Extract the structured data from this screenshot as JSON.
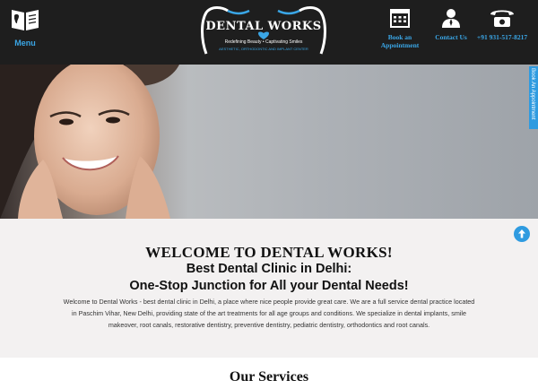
{
  "header": {
    "menu_label": "Menu",
    "logo": {
      "title": "DENTAL WORKS",
      "tagline": "Redefining Beauty • Captivating Smiles",
      "subtitle": "AESTHETIC, ORTHODONTIC AND IMPLANT CENTER"
    },
    "book_label_line1": "Book an",
    "book_label_line2": "Appointment",
    "contact_label": "Contact Us",
    "phone": "+91 931-517-8217"
  },
  "side_tab": {
    "label": "Book An Appointment"
  },
  "welcome": {
    "title": "WELCOME TO DENTAL WORKS!",
    "subtitle_line1": "Best Dental Clinic in Delhi:",
    "subtitle_line2": "One-Stop Junction for All your Dental Needs!",
    "body": "Welcome to Dental Works - best dental clinic in Delhi, a place where nice people provide great care. We are a full service dental practice located in Paschim Vihar, New Delhi, providing state of the art treatments for all age groups and conditions. We specialize in dental implants, smile makeover, root canals, restorative dentistry, preventive dentistry, pediatric dentistry, orthodontics and root canals."
  },
  "services": {
    "title": "Our Services"
  },
  "colors": {
    "accent": "#3aa6e6",
    "header_bg": "#1e1e1e",
    "page_bg": "#f3f1f1"
  },
  "icons": [
    "menu-book-icon",
    "tooth-logo-icon",
    "calendar-icon",
    "contact-person-icon",
    "phone-icon",
    "arrow-up-icon"
  ]
}
